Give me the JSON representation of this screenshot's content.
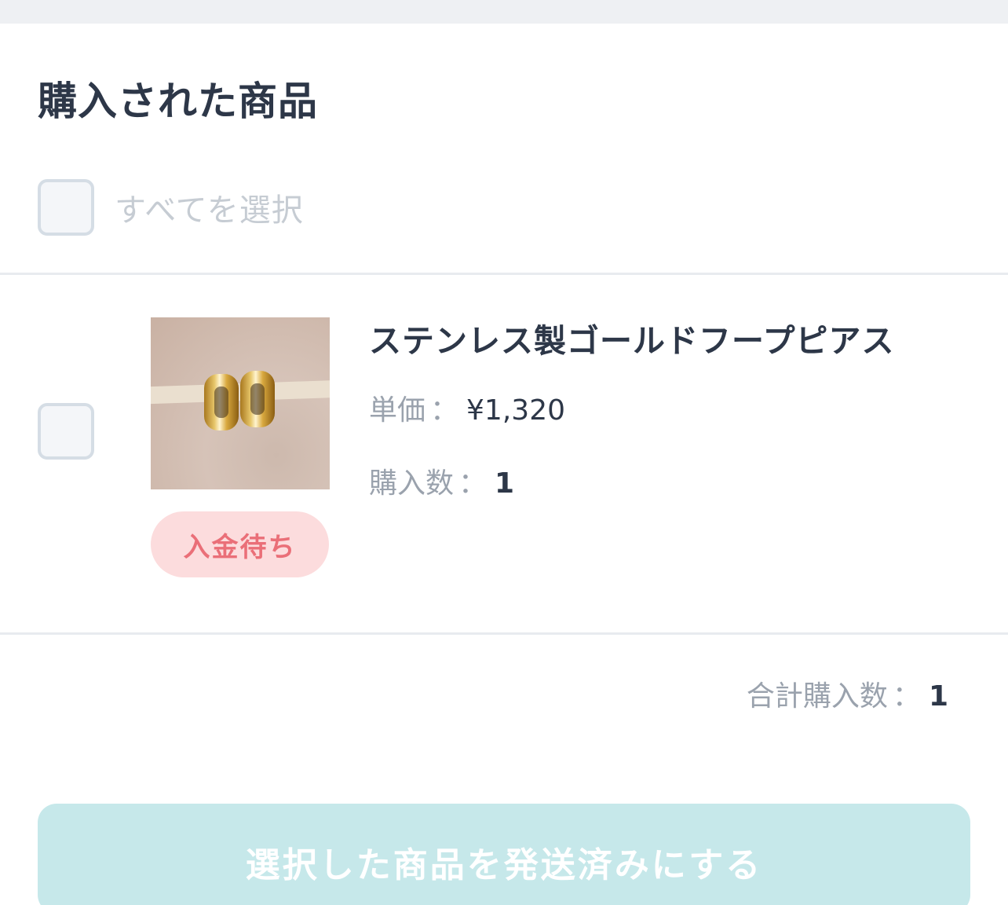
{
  "section": {
    "title": "購入された商品"
  },
  "select_all": {
    "label": "すべてを選択",
    "checked": false
  },
  "items": [
    {
      "name": "ステンレス製ゴールドフープピアス",
      "status": "入金待ち",
      "price_label": "単価",
      "separator": "：",
      "price": "¥1,320",
      "qty_label": "購入数",
      "qty": "1",
      "checked": false,
      "thumbnail": "gold-hoop-earrings-image"
    }
  ],
  "summary": {
    "total_label": "合計購入数",
    "separator": "：",
    "total_qty": "1"
  },
  "actions": {
    "mark_shipped_label": "選択した商品を発送済みにする"
  },
  "colors": {
    "badge_bg": "#fcdcdd",
    "badge_text": "#ea6f78",
    "button_bg": "#c6e8ea",
    "title_text": "#2d3748"
  }
}
